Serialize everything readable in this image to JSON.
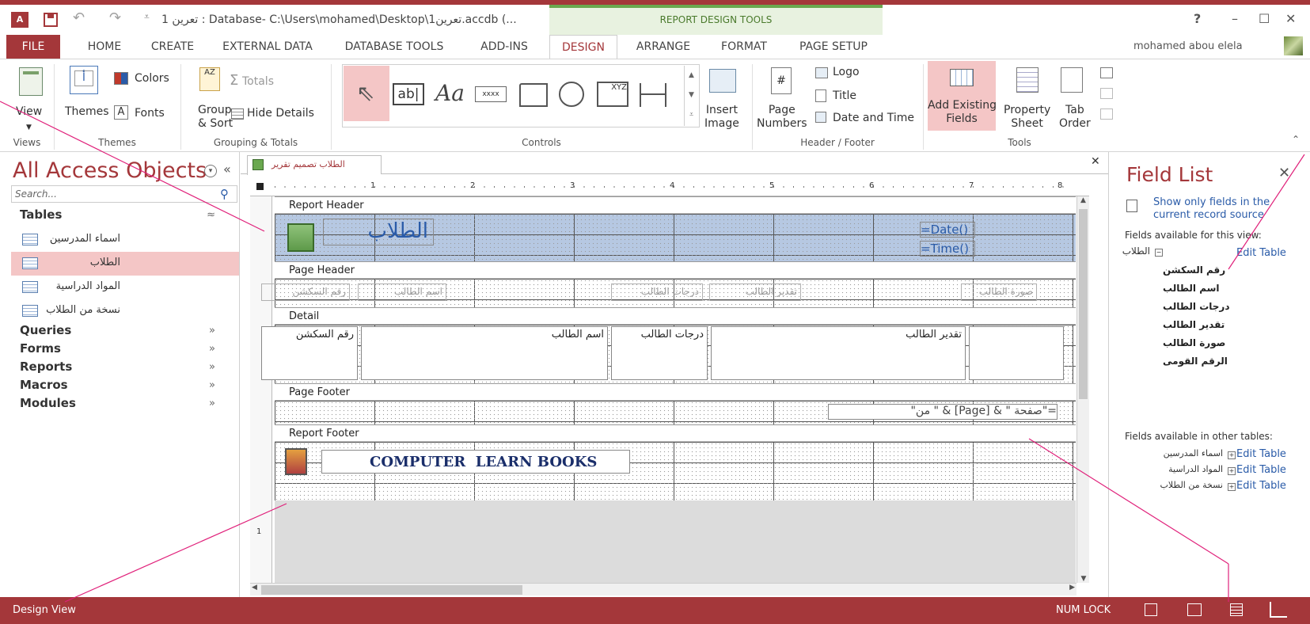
{
  "colors": {
    "accent": "#a4373a",
    "selected": "#f4c6c6",
    "contextual": "#e8f2e0",
    "link": "#2a5ba8",
    "callout": "#e0207a"
  },
  "titlebar": {
    "title": "تعرين 1 : Database- C:\\Users\\mohamed\\Desktop\\تعرين1.accdb (...",
    "contextual": "REPORT DESIGN TOOLS",
    "help": "?",
    "minimize": "–",
    "maximize": "☐",
    "close": "✕"
  },
  "tabs": {
    "file": "FILE",
    "home": "HOME",
    "create": "CREATE",
    "external": "EXTERNAL DATA",
    "dbtools": "DATABASE TOOLS",
    "addins": "ADD-INS",
    "design": "DESIGN",
    "arrange": "ARRANGE",
    "format": "FORMAT",
    "pagesetup": "PAGE SETUP",
    "user": "mohamed abou elela"
  },
  "ribbon": {
    "view": "View",
    "themes": "Themes",
    "colors": "Colors",
    "fonts": "Fonts",
    "group_sort": "Group\n& Sort",
    "totals": "Totals",
    "hide_details": "Hide Details",
    "insert_image": "Insert\nImage",
    "page_numbers": "Page\nNumbers",
    "logo": "Logo",
    "title": "Title",
    "date_time": "Date and Time",
    "add_fields": "Add Existing\nFields",
    "property_sheet": "Property\nSheet",
    "tab_order": "Tab\nOrder",
    "groups": {
      "views": "Views",
      "themes": "Themes",
      "grouping": "Grouping & Totals",
      "controls": "Controls",
      "header": "Header / Footer",
      "tools": "Tools"
    },
    "control_text": {
      "textbox": "ab|",
      "label": "Aa",
      "button": "xxxx",
      "xyz": "XYZ"
    }
  },
  "nav": {
    "title": "All Access Objects",
    "search": "Search...",
    "tables_label": "Tables",
    "tables": [
      "اسماء المدرسين",
      "الطلاب",
      "المواد الدراسية",
      "نسخة من الطلاب"
    ],
    "categories": [
      "Queries",
      "Forms",
      "Reports",
      "Macros",
      "Modules"
    ]
  },
  "doc": {
    "tab_title": "الطلاب تصميم تقرير",
    "bands": {
      "rh": "Report Header",
      "ph": "Page Header",
      "detail": "Detail",
      "pf": "Page Footer",
      "rf": "Report Footer"
    },
    "report_title": "الطلاب",
    "date_expr": "=Date()",
    "time_expr": "=Time()",
    "headers": [
      "رقم السكشن",
      "اسم الطالب",
      "درجات الطالب",
      "تقدير الطالب",
      "صورة الطالب"
    ],
    "details": [
      "رقم السكشن",
      "اسم الطالب",
      "درجات الطالب",
      "تقدير الطالب"
    ],
    "page_expr": "=\"صفحة \" & [Page] & \" من\"",
    "footer_text": "COMPUTER  LEARN BOOKS",
    "ruler_nums": [
      "1",
      "2",
      "3",
      "4",
      "5",
      "6",
      "7",
      "8"
    ],
    "vruler_num": "1"
  },
  "fieldlist": {
    "title": "Field List",
    "show_only": "Show only fields in the\ncurrent record source",
    "available": "Fields available for this view:",
    "table": "الطلاب",
    "edit": "Edit Table",
    "fields": [
      "رقم السكشن",
      "اسم الطالب",
      "درجات الطالب",
      "تقدير الطالب",
      "صورة الطالب",
      "الرقم القومى"
    ],
    "other": "Fields available in other tables:",
    "other_tables": [
      "اسماء المدرسين",
      "المواد الدراسية",
      "نسخة من الطلاب"
    ]
  },
  "status": {
    "view": "Design View",
    "numlock": "NUM LOCK"
  }
}
